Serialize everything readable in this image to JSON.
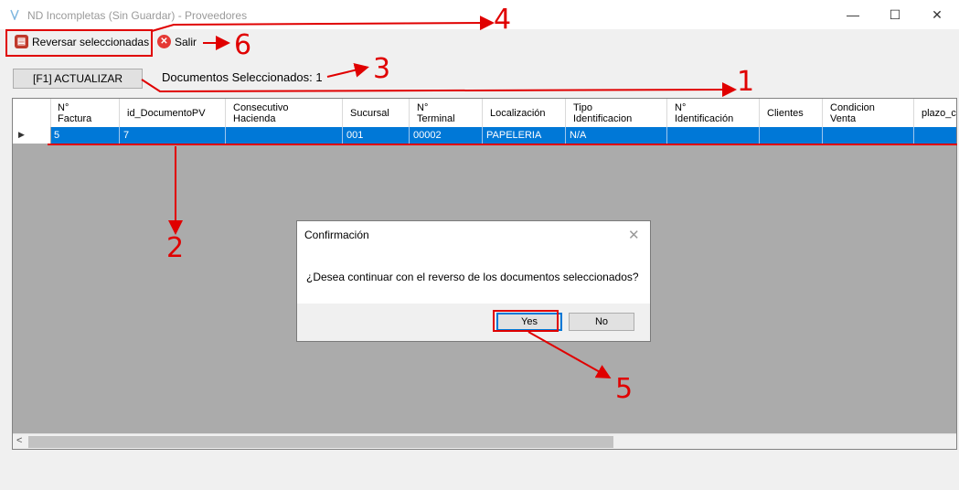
{
  "window": {
    "title": "ND Incompletas (Sin Guardar) - Proveedores",
    "minimize": "—",
    "maximize": "☐",
    "close": "✕"
  },
  "toolbar": {
    "reverse_label": "Reversar seleccionadas",
    "exit_label": "Salir"
  },
  "refresh_button": "[F1] ACTUALIZAR",
  "selected_docs": "Documentos Seleccionados: 1",
  "grid": {
    "columns": [
      "N°\nFactura",
      "id_DocumentoPV",
      "Consecutivo\nHacienda",
      "Sucursal",
      "N°\nTerminal",
      "Localización",
      "Tipo\nIdentificacion",
      "N°\nIdentificación",
      "Clientes",
      "Condicion\nVenta",
      "plazo_cr"
    ],
    "rows": [
      [
        "5",
        "7",
        "",
        "001",
        "00002",
        "PAPELERIA",
        "N/A",
        "",
        "",
        "",
        ""
      ]
    ],
    "row_marker": "▶"
  },
  "dialog": {
    "title": "Confirmación",
    "close": "✕",
    "message": "¿Desea continuar con el reverso de los documentos seleccionados?",
    "yes": "Yes",
    "no": "No"
  },
  "annotations": [
    "1",
    "2",
    "3",
    "4",
    "5",
    "6"
  ],
  "colors": {
    "selection": "#0078d7",
    "annotation": "#e00000",
    "grid_bg": "#ababab"
  }
}
